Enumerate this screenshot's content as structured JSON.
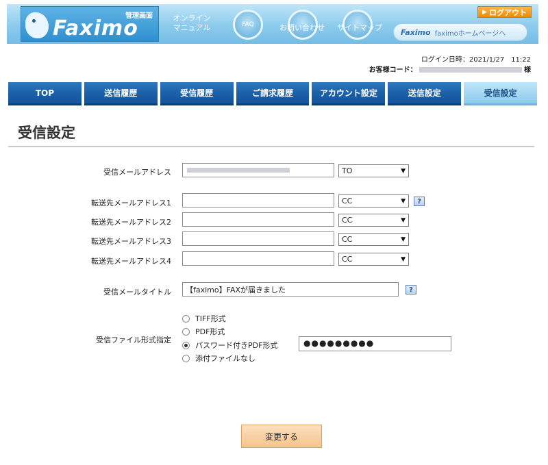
{
  "header": {
    "logo_text": "Faximo",
    "logo_sub": "管理画面",
    "nav": [
      {
        "label": "オンライン\nマニュアル"
      },
      {
        "label": "FAQ"
      },
      {
        "label": "お問い合わせ"
      },
      {
        "label": "サイトマップ"
      }
    ],
    "logout_label": "ログアウト",
    "home_logo": "Faximo",
    "home_label": "faximoホームページへ"
  },
  "login_info": {
    "login_time_label": "ログイン日時：",
    "login_time": "2021/1/27　11:22",
    "customer_code_label": "お客様コード：",
    "customer_suffix": "様"
  },
  "tabs": [
    {
      "label": "TOP",
      "active": false
    },
    {
      "label": "送信履歴",
      "active": false
    },
    {
      "label": "受信履歴",
      "active": false
    },
    {
      "label": "ご請求履歴",
      "active": false
    },
    {
      "label": "アカウント設定",
      "active": false
    },
    {
      "label": "送信設定",
      "active": false
    },
    {
      "label": "受信設定",
      "active": true
    }
  ],
  "page_title": "受信設定",
  "form": {
    "recv_mail": {
      "label": "受信メールアドレス",
      "value": "",
      "select": "TO"
    },
    "forwards": [
      {
        "label": "転送先メールアドレス1",
        "value": "",
        "select": "CC"
      },
      {
        "label": "転送先メールアドレス2",
        "value": "",
        "select": "CC"
      },
      {
        "label": "転送先メールアドレス3",
        "value": "",
        "select": "CC"
      },
      {
        "label": "転送先メールアドレス4",
        "value": "",
        "select": "CC"
      }
    ],
    "mail_title": {
      "label": "受信メールタイトル",
      "value": "【faximo】FAXが届きました"
    },
    "file_format": {
      "label": "受信ファイル形式指定",
      "options": [
        "TIFF形式",
        "PDF形式",
        "パスワード付きPDF形式",
        "添付ファイルなし"
      ],
      "selected": "パスワード付きPDF形式",
      "password_value": "●●●●●●●●●"
    },
    "help_icon": "?"
  },
  "submit_label": "変更する"
}
